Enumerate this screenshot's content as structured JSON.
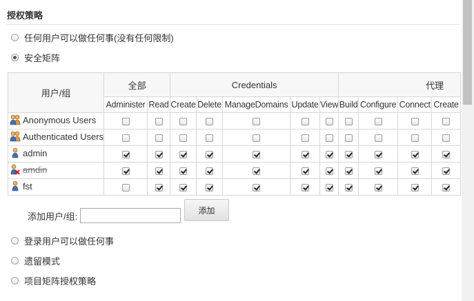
{
  "section": {
    "title": "授权策略"
  },
  "strategies": {
    "anyone": "任何用户可以做任何事(没有任何限制)",
    "matrix": "安全矩阵",
    "logged_in": "登录用户可以做任何事",
    "legacy": "遗留模式",
    "project_matrix": "项目矩阵授权策略"
  },
  "matrix": {
    "user_group_header": "用户/组",
    "groups": [
      "全部",
      "Credentials",
      "代理"
    ],
    "columns": [
      "Administer",
      "Read",
      "Create",
      "Delete",
      "ManageDomains",
      "Update",
      "View",
      "Build",
      "Configure",
      "Connect",
      "Create"
    ],
    "rows": [
      {
        "name": "Anonymous Users",
        "icon": "user-group-icon",
        "checks": [
          false,
          false,
          false,
          false,
          false,
          false,
          false,
          false,
          false,
          false,
          false
        ]
      },
      {
        "name": "Authenticated Users",
        "icon": "user-group-icon",
        "checks": [
          false,
          false,
          false,
          false,
          false,
          false,
          false,
          false,
          false,
          false,
          false
        ]
      },
      {
        "name": "admin",
        "icon": "user-icon",
        "checks": [
          true,
          true,
          true,
          true,
          true,
          true,
          true,
          true,
          true,
          true,
          true
        ]
      },
      {
        "name": "amdin",
        "icon": "unknown-user-icon",
        "checks": [
          true,
          true,
          true,
          true,
          true,
          true,
          true,
          true,
          true,
          true,
          true
        ]
      },
      {
        "name": "fst",
        "icon": "user-icon",
        "checks": [
          false,
          true,
          true,
          true,
          true,
          true,
          true,
          true,
          true,
          true,
          true
        ]
      }
    ]
  },
  "add_user": {
    "label": "添加用户/组:",
    "value": "",
    "button": "添加"
  }
}
